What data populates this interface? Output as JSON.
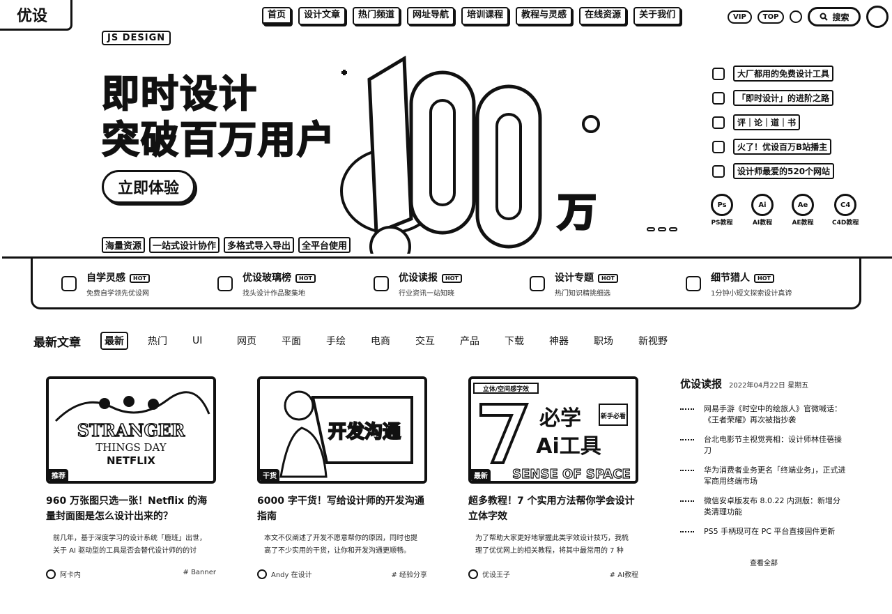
{
  "header": {
    "logo": "优设",
    "nav": [
      "首页",
      "设计文章",
      "热门频道",
      "网址导航",
      "培训课程",
      "教程与灵感",
      "在线资源",
      "关于我们"
    ],
    "right": {
      "pill_left": "VIP",
      "pill_right": "TOP",
      "search_label": "搜索"
    }
  },
  "hero": {
    "badge": "JS DESIGN",
    "title_line1": "即时设计",
    "title_line2": "突破百万用户",
    "cta": "立即体验",
    "taglines": [
      "海量资源",
      "一站式设计协作",
      "多格式导入导出",
      "全平台使用"
    ],
    "big_number": "100",
    "big_unit": "万",
    "promos": [
      "大厂都用的免费设计工具",
      "「即时设计」的进阶之路",
      "评｜论｜道｜书",
      "火了！优设百万B站播主",
      "设计师最爱的520个网站"
    ],
    "tools": [
      "PS教程",
      "AI教程",
      "AE教程",
      "C4D教程"
    ]
  },
  "features": [
    {
      "title": "自学灵感",
      "desc": "免费自学领先优设网"
    },
    {
      "title": "优设玻璃榜",
      "desc": "找头设计作品聚集地"
    },
    {
      "title": "优设读报",
      "desc": "行业资讯一站知晓"
    },
    {
      "title": "设计专题",
      "desc": "热门知识精挑细选"
    },
    {
      "title": "细节猎人",
      "desc": "1分钟小短文探索设计真谛"
    }
  ],
  "feature_badge": "HOT",
  "tabs": {
    "title": "最新文章",
    "items": [
      "最新",
      "热门",
      "UI",
      "网页",
      "平面",
      "手绘",
      "电商",
      "交互",
      "产品",
      "下载",
      "神器",
      "职场",
      "新视野"
    ]
  },
  "cards": [
    {
      "tag": "推荐",
      "title": "960 万张图只选一张！Netflix 的海量封面图是怎么设计出来的？",
      "excerpt": "前几年，基于深度学习的设计系统「鹿班」出世，关于 AI 驱动型的工具是否会替代设计师的的讨",
      "author": "阿卡内",
      "category": "Banner",
      "thumb_lines": [
        "STRANGER",
        "THINGS DAY",
        "NETFLIX"
      ]
    },
    {
      "tag": "干货",
      "title": "6000 字干货！写给设计师的开发沟通指南",
      "excerpt": "本文不仅阐述了开发不愿意帮你的原因，同时也提高了不少实用的干货，让你和开发沟通更顺畅。",
      "author": "Andy 在设计",
      "category": "经验分享",
      "thumb_lines": [
        "开发沟通"
      ]
    },
    {
      "tag": "最新",
      "title": "超多教程！7 个实用方法帮你学会设计立体字效",
      "excerpt": "为了帮助大家更好地掌握此类字效设计技巧，我梳理了优优网上的相关教程，将其中最常用的 7 种",
      "author": "优设王子",
      "category": "AI教程",
      "thumb_lines": [
        "立体/空间感字效",
        "必学",
        "Ai工具",
        "新手必看",
        "SENSE OF SPACE"
      ]
    }
  ],
  "sidebar": {
    "title": "优设读报",
    "date": "2022年04月22日 星期五",
    "items": [
      "网易手游《时空中的绘旅人》官微喊话：《王者荣耀》再次被指抄袭",
      "台北电影节主视觉亮相：设计师林佳蓓操刀",
      "华为消费者业务更名「终端业务」，正式进军商用终端市场",
      "微信安卓版发布 8.0.22 内测版：新增分类清理功能",
      "PS5 手柄现可在 PC 平台直接固件更新"
    ],
    "view_all": "查看全部"
  }
}
